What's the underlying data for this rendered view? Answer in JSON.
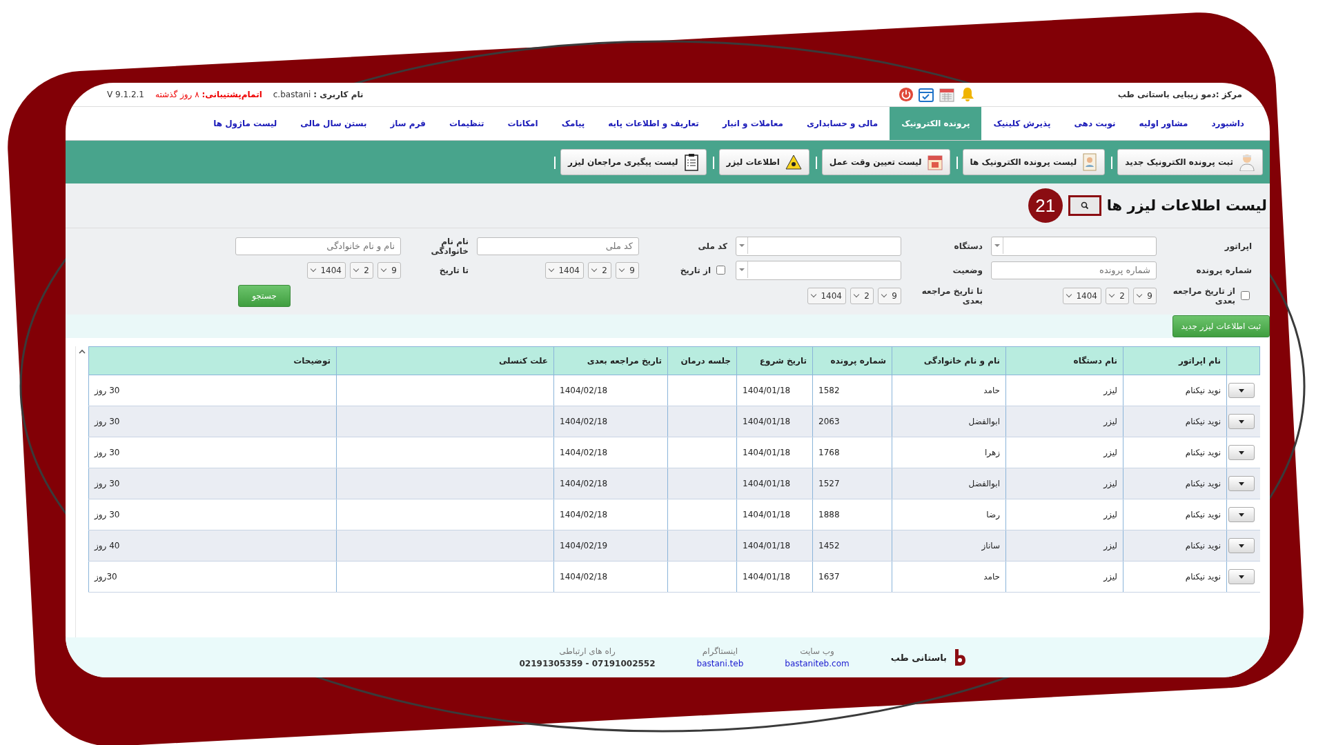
{
  "top_bar": {
    "center": "مرکز :دمو زیبایی باستانی طب",
    "user_label": "نام کاربری :",
    "user": "c.bastani",
    "support_label": "اتمام‌پشتیبانی:",
    "support_value": "۸ روز گذشته",
    "version": "V 9.1.2.1"
  },
  "nav_tabs": [
    {
      "label": "داشبورد",
      "selected": false
    },
    {
      "label": "مشاور اولیه",
      "selected": false
    },
    {
      "label": "نوبت دهی",
      "selected": false
    },
    {
      "label": "پذیرش کلینیک",
      "selected": false
    },
    {
      "label": "پرونده الکترونیک",
      "selected": true
    },
    {
      "label": "مالی و حسابداری",
      "selected": false
    },
    {
      "label": "معاملات و انبار",
      "selected": false
    },
    {
      "label": "تعاریف و اطلاعات پایه",
      "selected": false
    },
    {
      "label": "پیامک",
      "selected": false
    },
    {
      "label": "امکانات",
      "selected": false
    },
    {
      "label": "تنظیمات",
      "selected": false
    },
    {
      "label": "فرم ساز",
      "selected": false
    },
    {
      "label": "بستن سال مالی",
      "selected": false
    },
    {
      "label": "لیست ماژول ها",
      "selected": false
    }
  ],
  "toolbar": [
    {
      "label": "ثبت پرونده الکترونیک جدید",
      "kind": "doctor"
    },
    {
      "label": "لیست پرونده الکترونیک ها",
      "kind": "file"
    },
    {
      "label": "لیست تعیین وقت عمل",
      "kind": "calendar"
    },
    {
      "label": "اطلاعات لیزر",
      "kind": "warning"
    },
    {
      "label": "لیست پیگیری مراجعان لیزر",
      "kind": "clipboard"
    }
  ],
  "page_title": "لیست اطلاعات لیزر ها",
  "badge": "21",
  "filters": {
    "operator_label": "اپراتور",
    "device_label": "دستگاه",
    "national_code_label": "کد ملی",
    "national_code_placeholder": "کد ملی",
    "full_name_label": "نام نام خانوادگی",
    "full_name_placeholder": "نام و نام خانوادگی",
    "file_number_label": "شماره پرونده",
    "file_number_placeholder": "شماره پرونده",
    "status_label": "وضعیت",
    "from_date": {
      "label": "از تاریخ",
      "checked": false,
      "day": "9",
      "month": "2",
      "year": "1404"
    },
    "to_date": {
      "label": "تا تاریخ",
      "day": "9",
      "month": "2",
      "year": "1404"
    },
    "from_next_visit": {
      "label": "از تاریخ مراجعه بعدی",
      "checked": false,
      "day": "9",
      "month": "2",
      "year": "1404"
    },
    "to_next_visit": {
      "label": "تا تاریخ مراجعه بعدی",
      "day": "9",
      "month": "2",
      "year": "1404"
    },
    "search_button": "جستجو"
  },
  "new_button": "ثبت اطلاعات لیزر جدید",
  "table": {
    "columns": [
      "نام اپراتور",
      "نام دستگاه",
      "نام و نام خانوادگی",
      "شماره پرونده",
      "تاریخ شروع",
      "جلسه درمان",
      "تاریخ مراجعه بعدی",
      "علت کنسلی",
      "توضیحات"
    ],
    "rows": [
      {
        "operator": "نوید نیکنام",
        "device": "لیزر",
        "name": "حامد",
        "file": "1582",
        "start": "1404/01/18",
        "next": "1404/02/18",
        "note": "30 روز"
      },
      {
        "operator": "نوید نیکنام",
        "device": "لیزر",
        "name": "ابوالفضل",
        "file": "2063",
        "start": "1404/01/18",
        "next": "1404/02/18",
        "note": "30 روز"
      },
      {
        "operator": "نوید نیکنام",
        "device": "لیزر",
        "name": "زهرا",
        "file": "1768",
        "start": "1404/01/18",
        "next": "1404/02/18",
        "note": "30 روز"
      },
      {
        "operator": "نوید نیکنام",
        "device": "لیزر",
        "name": "ابوالفضل",
        "file": "1527",
        "start": "1404/01/18",
        "next": "1404/02/18",
        "note": "30 روز"
      },
      {
        "operator": "نوید نیکنام",
        "device": "لیزر",
        "name": "رضا",
        "file": "1888",
        "start": "1404/01/18",
        "next": "1404/02/18",
        "note": "30 روز"
      },
      {
        "operator": "نوید نیکنام",
        "device": "لیزر",
        "name": "ساناز",
        "file": "1452",
        "start": "1404/01/18",
        "next": "1404/02/19",
        "note": "40 روز"
      },
      {
        "operator": "نوید نیکنام",
        "device": "لیزر",
        "name": "حامد",
        "file": "1637",
        "start": "1404/01/18",
        "next": "1404/02/18",
        "note": "30روز"
      }
    ]
  },
  "footer": {
    "brand": "باستانی طب",
    "website_label": "وب سایت",
    "website": "bastaniteb.com",
    "instagram_label": "اینستاگرام",
    "instagram": "bastani.teb",
    "contact_label": "راه های ارتباطی",
    "phones": "07191002552 - 02191305359"
  }
}
